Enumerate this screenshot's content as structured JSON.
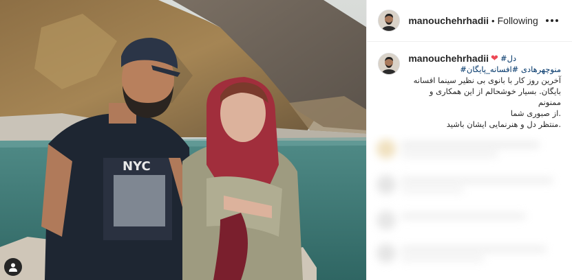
{
  "post": {
    "username": "manouchehrhadii",
    "separator": "•",
    "follow_status": "Following",
    "caption": {
      "username": "manouchehrhadii",
      "tag_first": "دل#",
      "tags_line": "منوچهرهادی #افسانه_پایگان#",
      "lines": [
        "آخرین روز کار با بانوی بی نظیر سینما افسانه",
        "بایگان. بسیار خوشحالم از این همکاری و ممنونم",
        ".از صبوری شما",
        ".منتظر دل و هنرنمایی ایشان باشید"
      ]
    }
  },
  "photo": {
    "tshirt_text": "NYC"
  },
  "icons": {
    "heart": "heart-icon",
    "more": "more-options-icon",
    "user": "user-icon"
  },
  "colors": {
    "tag": "#003569",
    "heart": "#ed4956"
  }
}
